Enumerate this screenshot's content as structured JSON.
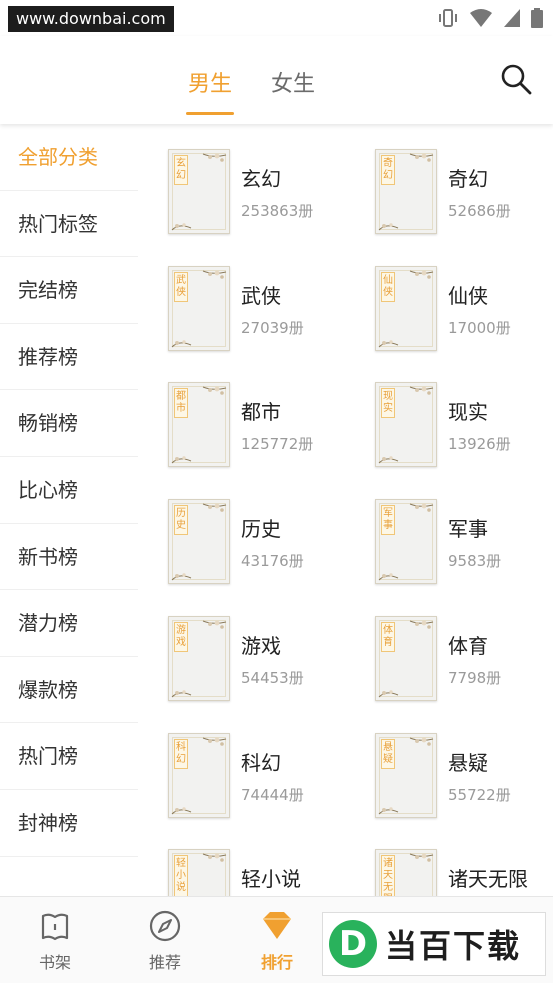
{
  "status_bar": {
    "watermark": "www.downbai.com",
    "icons": [
      "vibrate-icon",
      "wifi-icon",
      "signal-icon",
      "battery-icon"
    ]
  },
  "header": {
    "tabs": [
      {
        "label": "男生",
        "active": true
      },
      {
        "label": "女生",
        "active": false
      }
    ],
    "search_icon": "search-icon"
  },
  "sidebar": {
    "items": [
      {
        "label": "全部分类",
        "active": true
      },
      {
        "label": "热门标签",
        "active": false
      },
      {
        "label": "完结榜",
        "active": false
      },
      {
        "label": "推荐榜",
        "active": false
      },
      {
        "label": "畅销榜",
        "active": false
      },
      {
        "label": "比心榜",
        "active": false
      },
      {
        "label": "新书榜",
        "active": false
      },
      {
        "label": "潜力榜",
        "active": false
      },
      {
        "label": "爆款榜",
        "active": false
      },
      {
        "label": "热门榜",
        "active": false
      },
      {
        "label": "封神榜",
        "active": false
      }
    ]
  },
  "categories": [
    {
      "name": "玄幻",
      "count": "253863册",
      "cover_label": "玄幻"
    },
    {
      "name": "奇幻",
      "count": "52686册",
      "cover_label": "奇幻"
    },
    {
      "name": "武侠",
      "count": "27039册",
      "cover_label": "武侠"
    },
    {
      "name": "仙侠",
      "count": "17000册",
      "cover_label": "仙侠"
    },
    {
      "name": "都市",
      "count": "125772册",
      "cover_label": "都市"
    },
    {
      "name": "现实",
      "count": "13926册",
      "cover_label": "现实"
    },
    {
      "name": "历史",
      "count": "43176册",
      "cover_label": "历史"
    },
    {
      "name": "军事",
      "count": "9583册",
      "cover_label": "军事"
    },
    {
      "name": "游戏",
      "count": "54453册",
      "cover_label": "游戏"
    },
    {
      "name": "体育",
      "count": "7798册",
      "cover_label": "体育"
    },
    {
      "name": "科幻",
      "count": "74444册",
      "cover_label": "科幻"
    },
    {
      "name": "悬疑",
      "count": "55722册",
      "cover_label": "悬疑"
    },
    {
      "name": "轻小说",
      "count": "",
      "cover_label": "轻小说"
    },
    {
      "name": "诸天无限",
      "count": "",
      "cover_label": "诸天无限"
    }
  ],
  "bottom_nav": {
    "items": [
      {
        "label": "书架",
        "icon": "bookshelf-icon",
        "active": false
      },
      {
        "label": "推荐",
        "icon": "compass-icon",
        "active": false
      },
      {
        "label": "排行",
        "icon": "diamond-icon",
        "active": true
      }
    ]
  },
  "watermark_bottom": {
    "logo": "D",
    "text": "当百下载"
  },
  "colors": {
    "accent": "#f0a030",
    "text": "#333333",
    "muted": "#9a9a9a"
  }
}
